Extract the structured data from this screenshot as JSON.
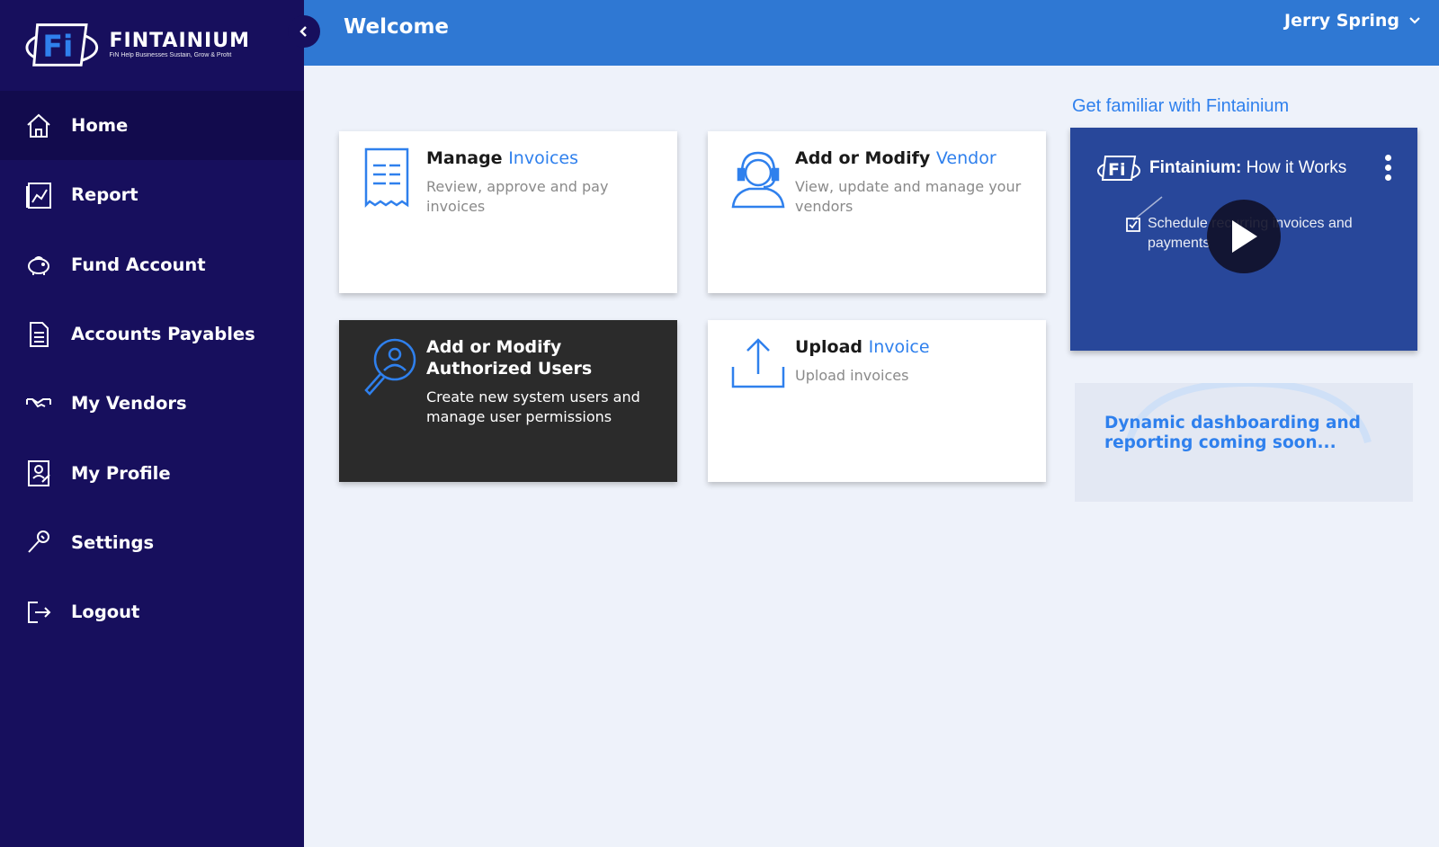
{
  "brand": {
    "logo_letters": "Fi",
    "name": "FINTAINIUM",
    "tagline": "FiN Help Businesses Sustain, Grow & Profit"
  },
  "sidebar": {
    "items": [
      {
        "label": "Home",
        "icon": "home-icon",
        "active": true
      },
      {
        "label": "Report",
        "icon": "report-chart-icon",
        "active": false
      },
      {
        "label": "Fund Account",
        "icon": "piggy-bank-icon",
        "active": false
      },
      {
        "label": "Accounts Payables",
        "icon": "document-icon",
        "active": false
      },
      {
        "label": "My Vendors",
        "icon": "handshake-icon",
        "active": false
      },
      {
        "label": "My Profile",
        "icon": "profile-card-icon",
        "active": false
      },
      {
        "label": "Settings",
        "icon": "wrench-icon",
        "active": false
      },
      {
        "label": "Logout",
        "icon": "logout-icon",
        "active": false
      }
    ]
  },
  "header": {
    "title": "Welcome",
    "user_name": "Jerry Spring"
  },
  "cards": [
    {
      "title": "Manage ",
      "title_accent": "Invoices",
      "description": "Review, approve and pay invoices",
      "icon": "invoice-receipt-icon"
    },
    {
      "title": "Add or Modify ",
      "title_accent": "Vendor",
      "description": "View, update and manage your vendors",
      "icon": "headset-user-icon"
    },
    {
      "title": "Add or Modify Authorized Users",
      "title_accent": "",
      "description": "Create new system users and manage user permissions",
      "icon": "user-search-icon"
    },
    {
      "title": "Upload ",
      "title_accent": "Invoice",
      "description": "Upload invoices",
      "icon": "upload-icon"
    }
  ],
  "right_panel": {
    "heading": "Get familiar with Fintainium",
    "video": {
      "title_bold": "Fintainium:",
      "title_rest": " How it Works",
      "feature_text": "Schedule recurring invoices and payments"
    },
    "coming_soon": "Dynamic dashboarding and reporting coming soon..."
  },
  "colors": {
    "sidebar": "#170f5d",
    "header": "#2f78d3",
    "accent": "#2f80ed",
    "video_bg": "#28479a"
  }
}
